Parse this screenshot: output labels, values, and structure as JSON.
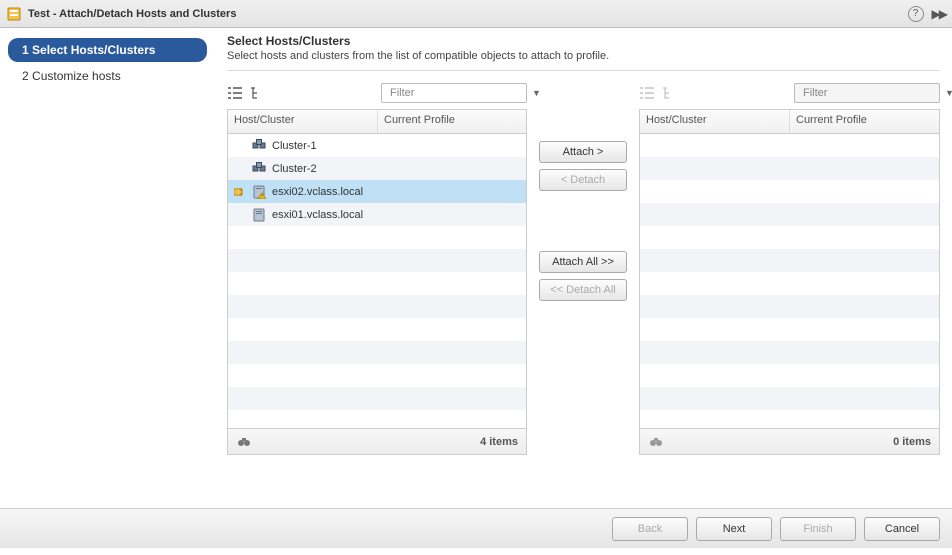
{
  "titlebar": {
    "title": "Test - Attach/Detach Hosts and Clusters"
  },
  "steps": {
    "step1": {
      "number": "1",
      "label": "Select Hosts/Clusters"
    },
    "step2": {
      "number": "2",
      "label": "Customize hosts"
    }
  },
  "header": {
    "title": "Select Hosts/Clusters",
    "subtitle": "Select hosts and clusters from the list of compatible objects to attach to profile."
  },
  "filter": {
    "placeholder": "Filter"
  },
  "columns": {
    "hostcluster": "Host/Cluster",
    "profile": "Current Profile"
  },
  "left_rows": [
    {
      "icon": "cluster",
      "name": "Cluster-1",
      "profile": "",
      "selected": false
    },
    {
      "icon": "cluster",
      "name": "Cluster-2",
      "profile": "",
      "selected": false
    },
    {
      "icon": "host-warn",
      "name": "esxi02.vclass.local",
      "profile": "",
      "selected": true
    },
    {
      "icon": "host",
      "name": "esxi01.vclass.local",
      "profile": "",
      "selected": false
    }
  ],
  "right_rows": [],
  "counts": {
    "left": "4 items",
    "right": "0 items"
  },
  "transfer": {
    "attach": "Attach >",
    "detach": "< Detach",
    "attach_all": "Attach All >>",
    "detach_all": "<< Detach All"
  },
  "footer": {
    "back": "Back",
    "next": "Next",
    "finish": "Finish",
    "cancel": "Cancel"
  }
}
